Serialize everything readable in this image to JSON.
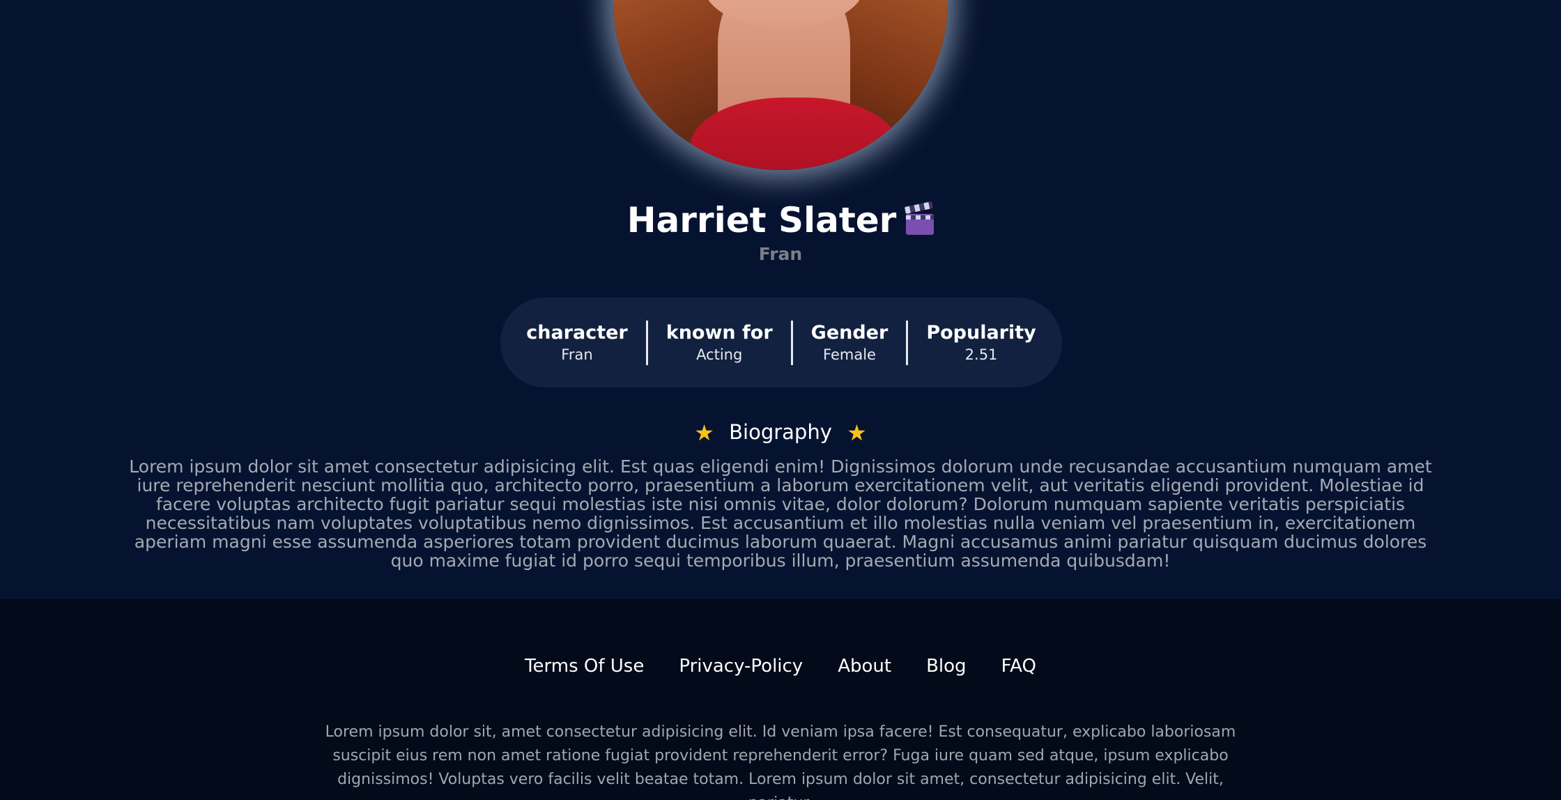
{
  "profile": {
    "name": "Harriet Slater",
    "character_name": "Fran",
    "name_icon": "clapper-board-icon"
  },
  "stats": [
    {
      "label": "character",
      "value": "Fran"
    },
    {
      "label": "known for",
      "value": "Acting"
    },
    {
      "label": "Gender",
      "value": "Female"
    },
    {
      "label": "Popularity",
      "value": "2.51"
    }
  ],
  "biography": {
    "title": "Biography",
    "icon": "star-icon",
    "text": "Lorem ipsum dolor sit amet consectetur adipisicing elit. Est quas eligendi enim! Dignissimos dolorum unde recusandae accusantium numquam amet iure reprehenderit nesciunt mollitia quo, architecto porro, praesentium a laborum exercitationem velit, aut veritatis eligendi provident. Molestiae id facere voluptas architecto fugit pariatur sequi molestias iste nisi omnis vitae, dolor dolorum? Dolorum numquam sapiente veritatis perspiciatis necessitatibus nam voluptates voluptatibus nemo dignissimos. Est accusantium et illo molestias nulla veniam vel praesentium in, exercitationem aperiam magni esse assumenda asperiores totam provident ducimus laborum quaerat. Magni accusamus animi pariatur quisquam ducimus dolores quo maxime fugiat id porro sequi temporibus illum, praesentium assumenda quibusdam!"
  },
  "footer": {
    "links": [
      "Terms Of Use",
      "Privacy-Policy",
      "About",
      "Blog",
      "FAQ"
    ],
    "text": "Lorem ipsum dolor sit, amet consectetur adipisicing elit. Id veniam ipsa facere! Est consequatur, explicabo laboriosam suscipit eius rem non amet ratione fugiat provident reprehenderit error? Fuga iure quam sed atque, ipsum explicabo dignissimos! Voluptas vero facilis velit beatae totam. Lorem ipsum dolor sit amet, consectetur adipisicing elit. Velit, pariatur."
  },
  "colors": {
    "background": "#061330",
    "footer_background": "#030a19",
    "stats_pill": "#12213f",
    "star": "#f8c21c"
  }
}
